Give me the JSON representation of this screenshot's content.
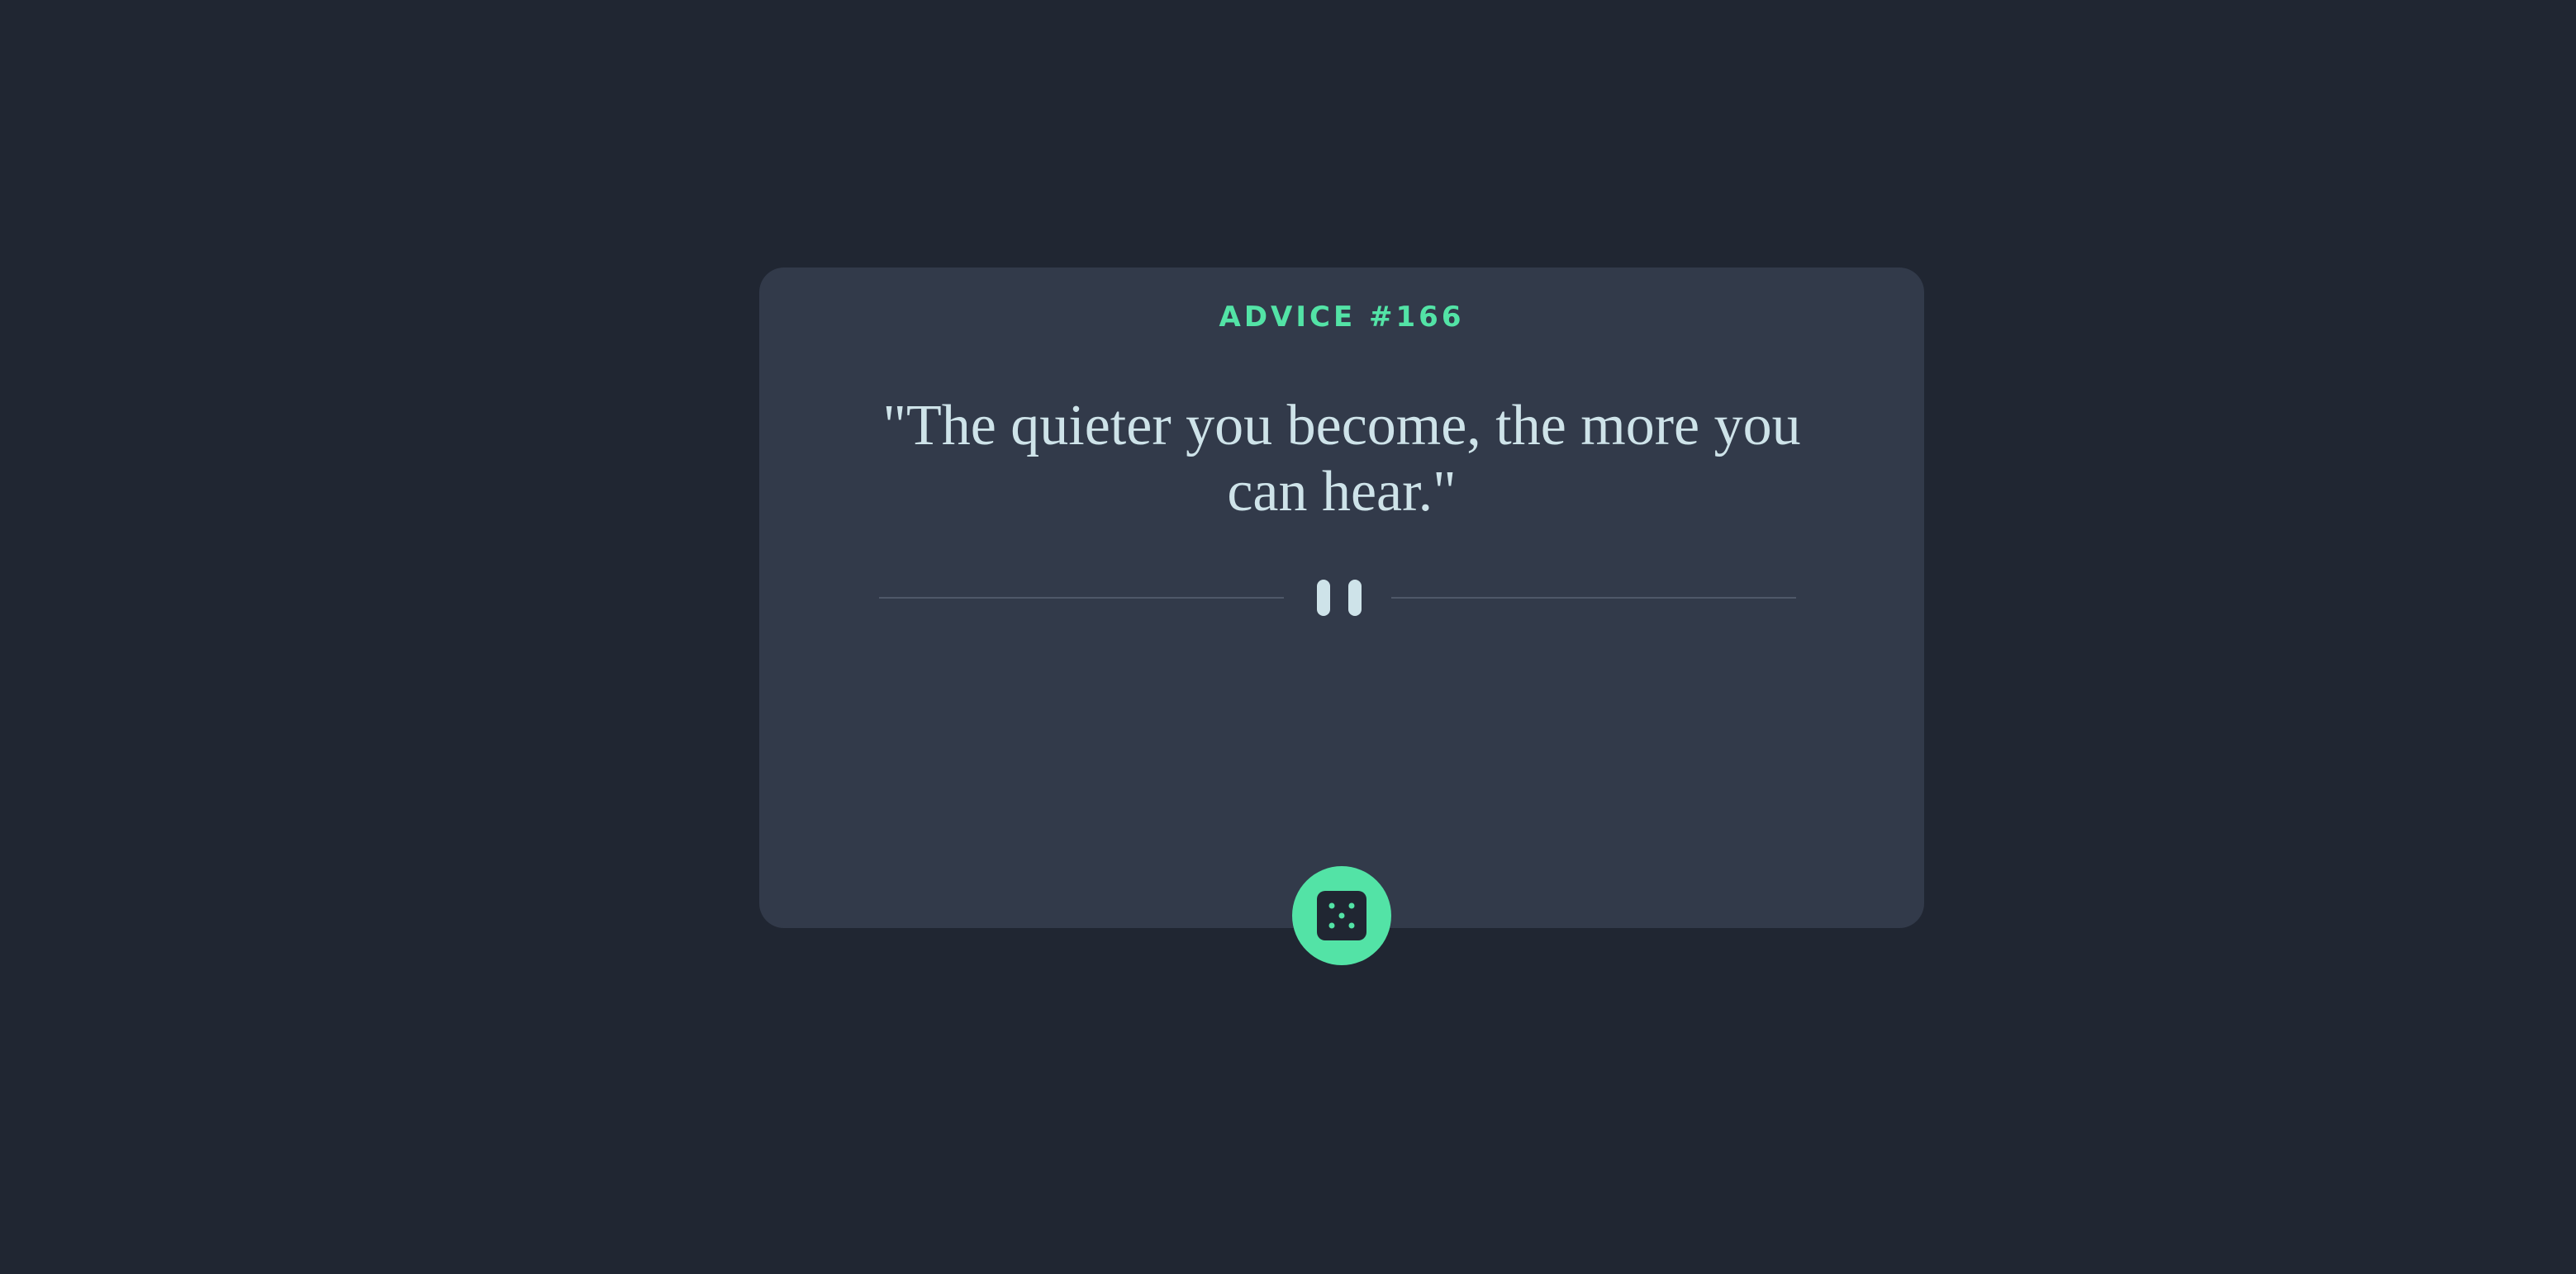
{
  "advice": {
    "id_label": "ADVICE #166",
    "text": "\"The quieter you become, the more you can hear.\""
  },
  "divider": {
    "icon": "pause-icon"
  },
  "dice_button": {
    "icon": "dice-icon"
  },
  "colors": {
    "background": "#202632",
    "card": "#323a4a",
    "accent": "#53e3a6",
    "text": "#cee3e9",
    "divider_line": "#4f5869"
  }
}
